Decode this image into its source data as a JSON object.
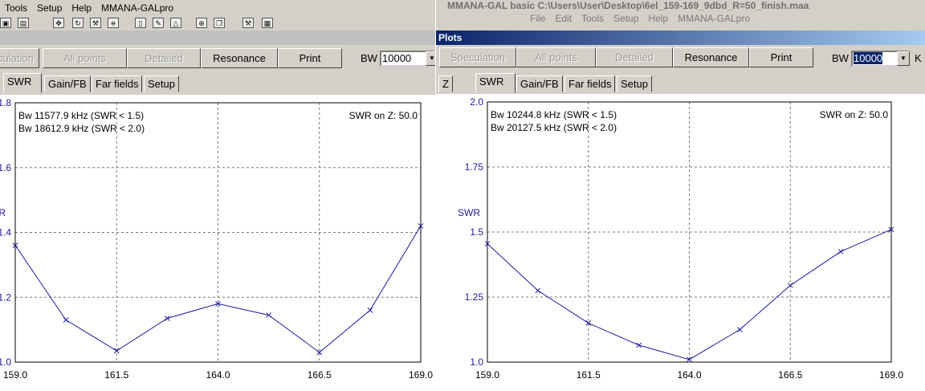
{
  "left_window": {
    "menu": [
      "Tools",
      "Setup",
      "Help",
      "MMANA-GALpro"
    ],
    "buttons": {
      "speculation": "culation",
      "all_points": "All points",
      "detailed": "Detailed",
      "resonance": "Resonance",
      "print": "Print"
    },
    "bw_label": "BW",
    "bw_value": "10000",
    "tabs": [
      "SWR",
      "Gain/FB",
      "Far fields",
      "Setup"
    ],
    "active_tab": "SWR"
  },
  "right_window": {
    "title": "MMANA-GAL basic C:\\Users\\User\\Desktop\\6el_159-169_9dbd_R=50_finish.maa",
    "menu": [
      "File",
      "Edit",
      "Tools",
      "Setup",
      "Help",
      "MMANA-GALpro"
    ],
    "plots_title": "Plots",
    "buttons": {
      "speculation": "Speculation",
      "all_points": "All points",
      "detailed": "Detailed",
      "resonance": "Resonance",
      "print": "Print"
    },
    "bw_label": "BW",
    "bw_value": "10000",
    "bw_unit": "K",
    "tabs": [
      "Z",
      "SWR",
      "Gain/FB",
      "Far fields",
      "Setup"
    ],
    "active_tab": "SWR"
  },
  "colors": {
    "plot_line": "#1a1a9c",
    "axis_text": "#1a1a9c",
    "titlebar": "#0a246a"
  },
  "chart_data": [
    {
      "type": "line",
      "ylabel": "/R",
      "annotations": [
        "Bw 11577.9 kHz (SWR < 1.5)",
        "Bw 18612.9 kHz (SWR < 2.0)",
        "SWR on Z: 50.0"
      ],
      "xlim": [
        159.0,
        169.0
      ],
      "ylim": [
        1.0,
        1.8
      ],
      "x_ticks": [
        "159.0",
        "161.5",
        "164.0",
        "166.5",
        "169.0"
      ],
      "y_ticks": [
        "1.0",
        "1.2",
        "1.4",
        "1.6",
        "1.8"
      ],
      "grid": true,
      "series": [
        {
          "x": [
            159.0,
            160.25,
            161.5,
            162.75,
            164.0,
            165.25,
            166.5,
            167.75,
            169.0
          ],
          "values": [
            1.36,
            1.13,
            1.035,
            1.135,
            1.18,
            1.145,
            1.03,
            1.16,
            1.42
          ]
        }
      ]
    },
    {
      "type": "line",
      "ylabel": "SWR",
      "annotations": [
        "Bw 10244.8 kHz (SWR < 1.5)",
        "Bw 20127.5 kHz (SWR < 2.0)",
        "SWR on Z: 50.0"
      ],
      "xlim": [
        159.0,
        169.0
      ],
      "ylim": [
        1.0,
        2.0
      ],
      "x_ticks": [
        "159.0",
        "161.5",
        "164.0",
        "166.5",
        "169.0"
      ],
      "y_ticks": [
        "1.0",
        "1.25",
        "1.5",
        "1.75",
        "2.0"
      ],
      "grid": true,
      "series": [
        {
          "x": [
            159.0,
            160.25,
            161.5,
            162.75,
            164.0,
            165.25,
            166.5,
            167.75,
            169.0
          ],
          "values": [
            1.455,
            1.275,
            1.15,
            1.065,
            1.01,
            1.125,
            1.295,
            1.425,
            1.51
          ]
        }
      ]
    }
  ]
}
